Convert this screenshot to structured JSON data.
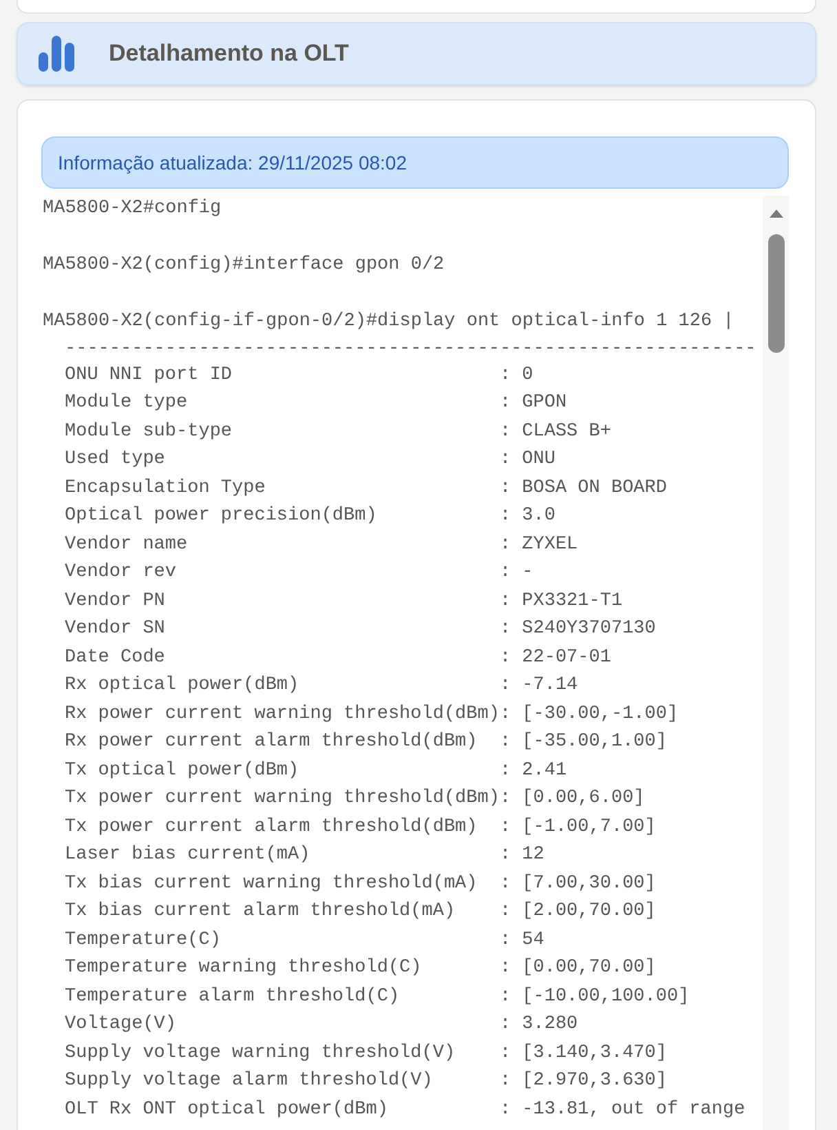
{
  "header": {
    "title": "Detalhamento na OLT"
  },
  "output": {
    "info_banner": "Informação atualizada: 29/11/2025 08:02",
    "terminal": {
      "commands": [
        "MA5800-X2#config",
        "MA5800-X2(config)#interface gpon 0/2",
        "MA5800-X2(config-if-gpon-0/2)#display ont optical-info 1 126 |"
      ],
      "separator": "--------------------------------------------------------------",
      "rows": [
        "ONU NNI port ID                        : 0",
        "Module type                            : GPON",
        "Module sub-type                        : CLASS B+",
        "Used type                              : ONU",
        "Encapsulation Type                     : BOSA ON BOARD",
        "Optical power precision(dBm)           : 3.0",
        "Vendor name                            : ZYXEL",
        "Vendor rev                             : -",
        "Vendor PN                              : PX3321-T1",
        "Vendor SN                              : S240Y3707130",
        "Date Code                              : 22-07-01",
        "Rx optical power(dBm)                  : -7.14",
        "Rx power current warning threshold(dBm): [-30.00,-1.00]",
        "Rx power current alarm threshold(dBm)  : [-35.00,1.00]",
        "Tx optical power(dBm)                  : 2.41",
        "Tx power current warning threshold(dBm): [0.00,6.00]",
        "Tx power current alarm threshold(dBm)  : [-1.00,7.00]",
        "Laser bias current(mA)                 : 12",
        "Tx bias current warning threshold(mA)  : [7.00,30.00]",
        "Tx bias current alarm threshold(mA)    : [2.00,70.00]",
        "Temperature(C)                         : 54",
        "Temperature warning threshold(C)       : [0.00,70.00]",
        "Temperature alarm threshold(C)         : [-10.00,100.00]",
        "Voltage(V)                             : 3.280",
        "Supply voltage warning threshold(V)    : [3.140,3.470]",
        "Supply voltage alarm threshold(V)      : [2.970,3.630]",
        "OLT Rx ONT optical power(dBm)          : -13.81, out of range"
      ]
    }
  }
}
